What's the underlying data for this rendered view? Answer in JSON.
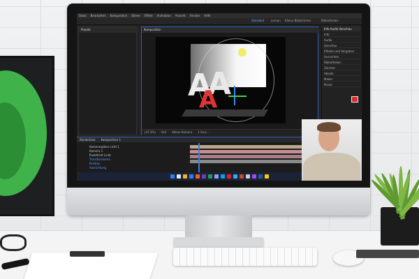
{
  "ae": {
    "menu": [
      "Datei",
      "Bearbeiten",
      "Komposition",
      "Ebene",
      "Effekt",
      "Animation",
      "Ansicht",
      "Fenster",
      "Hilfe"
    ],
    "workspaces": [
      "Standard",
      "Lernen",
      "Kleine Bildschirme",
      "Bibliotheken"
    ],
    "project_tab": "Projekt",
    "comp_tab": "Komposition",
    "right_panel": {
      "title": "Info Audio Vorschau",
      "rows": [
        "Info",
        "Audio",
        "Vorschau",
        "Effekte und Vorgaben",
        "Ausrichten",
        "Bibliotheken",
        "Zeichen",
        "Absatz",
        "Malen",
        "Pinsel"
      ]
    },
    "comp_footer": [
      "(47,3%)",
      "Voll",
      "Aktive Kamera",
      "1 Ansi..."
    ],
    "timeline_tabs": [
      "Renderliste",
      "Komposition 1"
    ],
    "layers": [
      {
        "name": "Kameraoption Licht 1",
        "blue": false
      },
      {
        "name": "Kamera 1",
        "blue": false
      },
      {
        "name": "Punktlicht Licht",
        "blue": false
      },
      {
        "name": "Transformieren",
        "blue": true
      },
      {
        "name": "Position",
        "blue": true
      },
      {
        "name": "Ausrichtung",
        "blue": true
      }
    ]
  },
  "colors": {
    "track_tan": "#b9a98a",
    "track_pink": "#c48d94",
    "track_rose": "#a87f86",
    "track_gray": "#8a8a8a"
  }
}
